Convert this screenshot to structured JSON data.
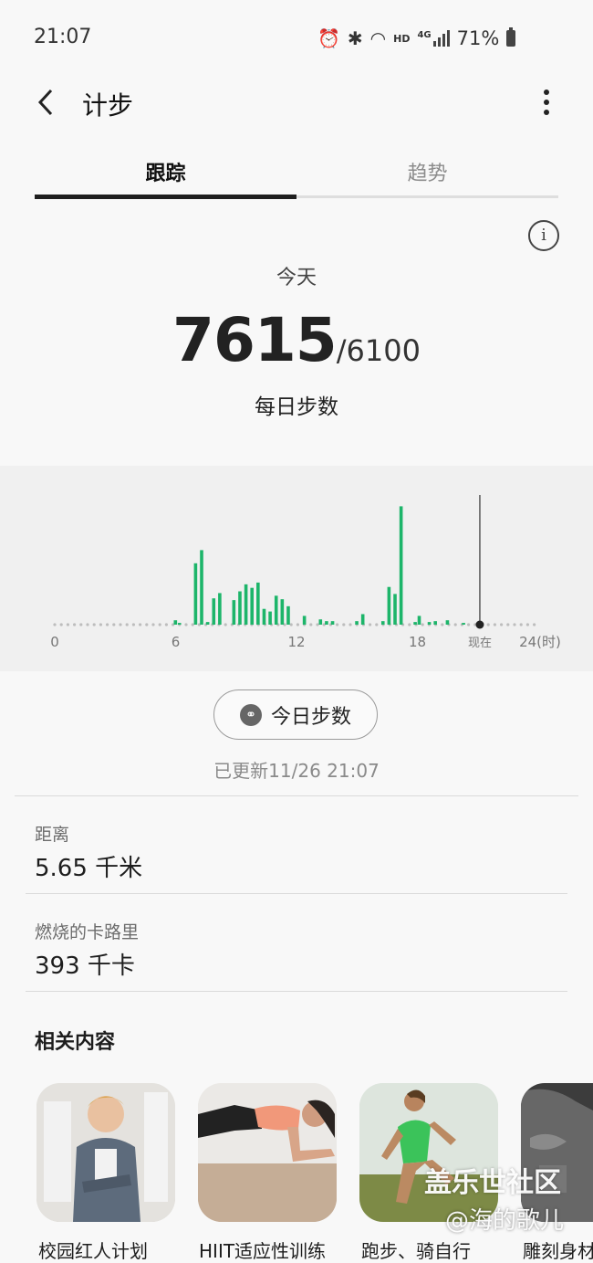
{
  "status_bar": {
    "time": "21:07",
    "battery": "71%",
    "icons": [
      "alarm-icon",
      "bluetooth-icon",
      "wifi-icon",
      "hd-icon",
      "4g-signal-icon",
      "battery-icon"
    ],
    "hd": "HD",
    "network": "4G"
  },
  "header": {
    "title": "计步",
    "back_icon": "back-arrow-icon",
    "menu_icon": "more-vertical-icon"
  },
  "tabs": [
    {
      "label": "跟踪",
      "active": true
    },
    {
      "label": "趋势",
      "active": false
    }
  ],
  "summary": {
    "info_icon": "info-icon",
    "info_glyph": "i",
    "period": "今天",
    "steps": "7615",
    "goal": "/6100",
    "label": "每日步数"
  },
  "chart_data": {
    "type": "bar",
    "x_axis_labels": [
      "0",
      "6",
      "12",
      "18",
      "现在",
      "24(时)"
    ],
    "x_tick_hours": [
      0,
      6,
      12,
      18,
      24
    ],
    "x_range": [
      0,
      24
    ],
    "now_hour": 21.1,
    "bars": [
      {
        "hour": 6.0,
        "value": 5
      },
      {
        "hour": 6.2,
        "value": 2
      },
      {
        "hour": 7.0,
        "value": 70
      },
      {
        "hour": 7.3,
        "value": 85
      },
      {
        "hour": 7.6,
        "value": 3
      },
      {
        "hour": 7.9,
        "value": 30
      },
      {
        "hour": 8.2,
        "value": 36
      },
      {
        "hour": 8.9,
        "value": 28
      },
      {
        "hour": 9.2,
        "value": 38
      },
      {
        "hour": 9.5,
        "value": 46
      },
      {
        "hour": 9.8,
        "value": 42
      },
      {
        "hour": 10.1,
        "value": 48
      },
      {
        "hour": 10.4,
        "value": 18
      },
      {
        "hour": 10.7,
        "value": 15
      },
      {
        "hour": 11.0,
        "value": 33
      },
      {
        "hour": 11.3,
        "value": 29
      },
      {
        "hour": 11.6,
        "value": 21
      },
      {
        "hour": 12.4,
        "value": 10
      },
      {
        "hour": 13.2,
        "value": 6
      },
      {
        "hour": 13.5,
        "value": 4
      },
      {
        "hour": 13.8,
        "value": 4
      },
      {
        "hour": 15.0,
        "value": 4
      },
      {
        "hour": 15.3,
        "value": 12
      },
      {
        "hour": 16.3,
        "value": 4
      },
      {
        "hour": 16.6,
        "value": 43
      },
      {
        "hour": 16.9,
        "value": 35
      },
      {
        "hour": 17.2,
        "value": 135
      },
      {
        "hour": 17.9,
        "value": 3
      },
      {
        "hour": 18.1,
        "value": 10
      },
      {
        "hour": 18.6,
        "value": 3
      },
      {
        "hour": 18.9,
        "value": 4
      },
      {
        "hour": 19.5,
        "value": 5
      },
      {
        "hour": 20.3,
        "value": 2
      }
    ],
    "bar_color": "#1db56a"
  },
  "today_steps_button": {
    "label": "今日步数",
    "icon": "link-icon"
  },
  "updated": "已更新11/26 21:07",
  "stats": {
    "distance": {
      "label": "距离",
      "value": "5.65 千米"
    },
    "calories": {
      "label": "燃烧的卡路里",
      "value": "393 千卡"
    }
  },
  "related": {
    "title": "相关内容",
    "cards": [
      {
        "title": "校园红人计划"
      },
      {
        "title": "HIIT适应性训练"
      },
      {
        "title": "跑步、骑自行"
      },
      {
        "title": "雕刻身材"
      }
    ]
  },
  "watermark": {
    "line1": "盖乐世社区",
    "line2": "@海的歌儿"
  }
}
